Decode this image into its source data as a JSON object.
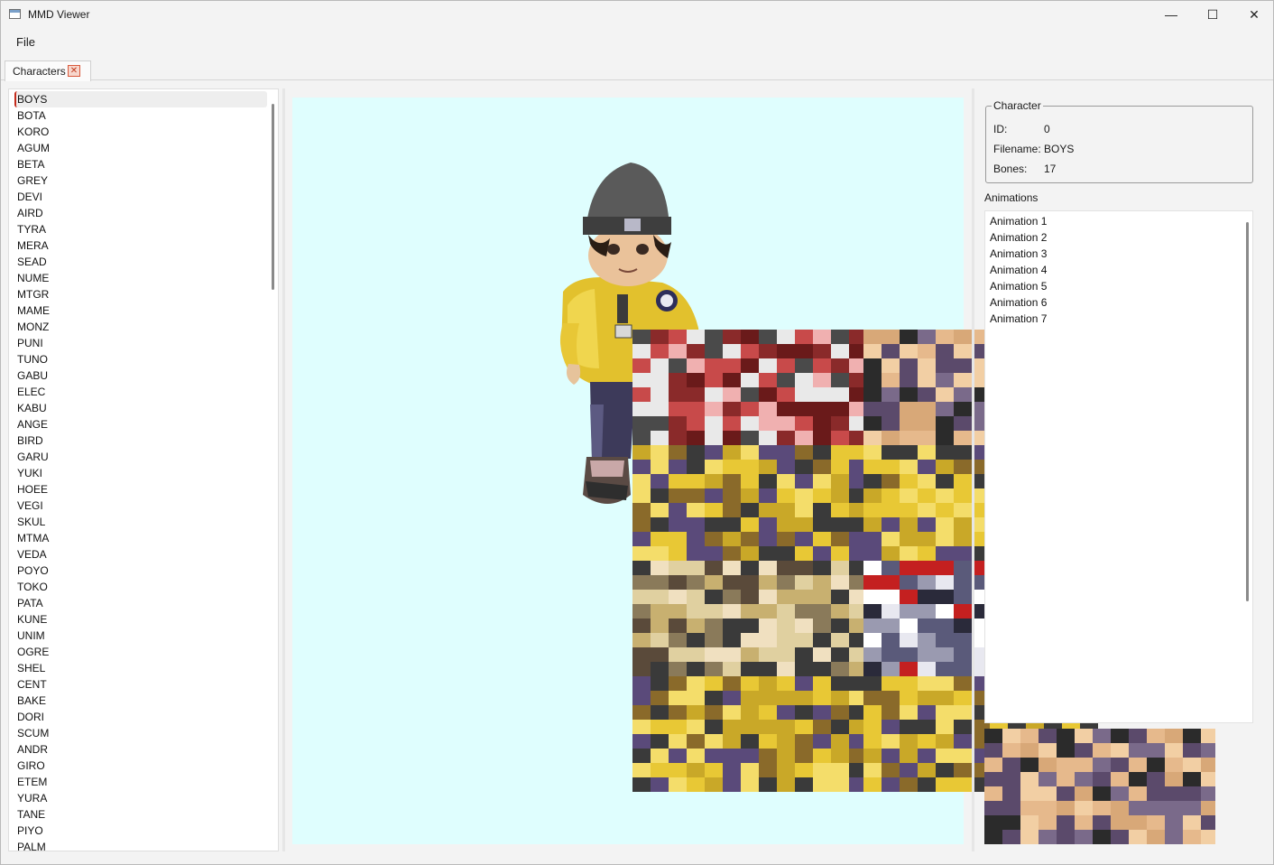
{
  "window": {
    "title": "MMD Viewer",
    "minimize": "—",
    "maximize": "☐",
    "close": "✕"
  },
  "menu": {
    "file": "File"
  },
  "tab": {
    "label": "Characters",
    "close_glyph": "✕"
  },
  "characters": [
    "BOYS",
    "BOTA",
    "KORO",
    "AGUM",
    "BETA",
    "GREY",
    "DEVI",
    "AIRD",
    "TYRA",
    "MERA",
    "SEAD",
    "NUME",
    "MTGR",
    "MAME",
    "MONZ",
    "PUNI",
    "TUNO",
    "GABU",
    "ELEC",
    "KABU",
    "ANGE",
    "BIRD",
    "GARU",
    "YUKI",
    "HOEE",
    "VEGI",
    "SKUL",
    "MTMA",
    "VEDA",
    "POYO",
    "TOKO",
    "PATA",
    "KUNE",
    "UNIM",
    "OGRE",
    "SHEL",
    "CENT",
    "BAKE",
    "DORI",
    "SCUM",
    "ANDR",
    "GIRO",
    "ETEM",
    "YURA",
    "TANE",
    "PIYO",
    "PALM"
  ],
  "selected_index": 0,
  "character": {
    "group_title": "Character",
    "id_label": "ID:",
    "id_value": "0",
    "filename_label": "Filename:",
    "filename_value": "BOYS",
    "bones_label": "Bones:",
    "bones_value": "17"
  },
  "animations": {
    "label": "Animations",
    "items": [
      "Animation 1",
      "Animation 2",
      "Animation 3",
      "Animation 4",
      "Animation 5",
      "Animation 6",
      "Animation 7"
    ]
  },
  "colors": {
    "viewport_bg": "#dffefe",
    "accent": "#c42b1c"
  }
}
